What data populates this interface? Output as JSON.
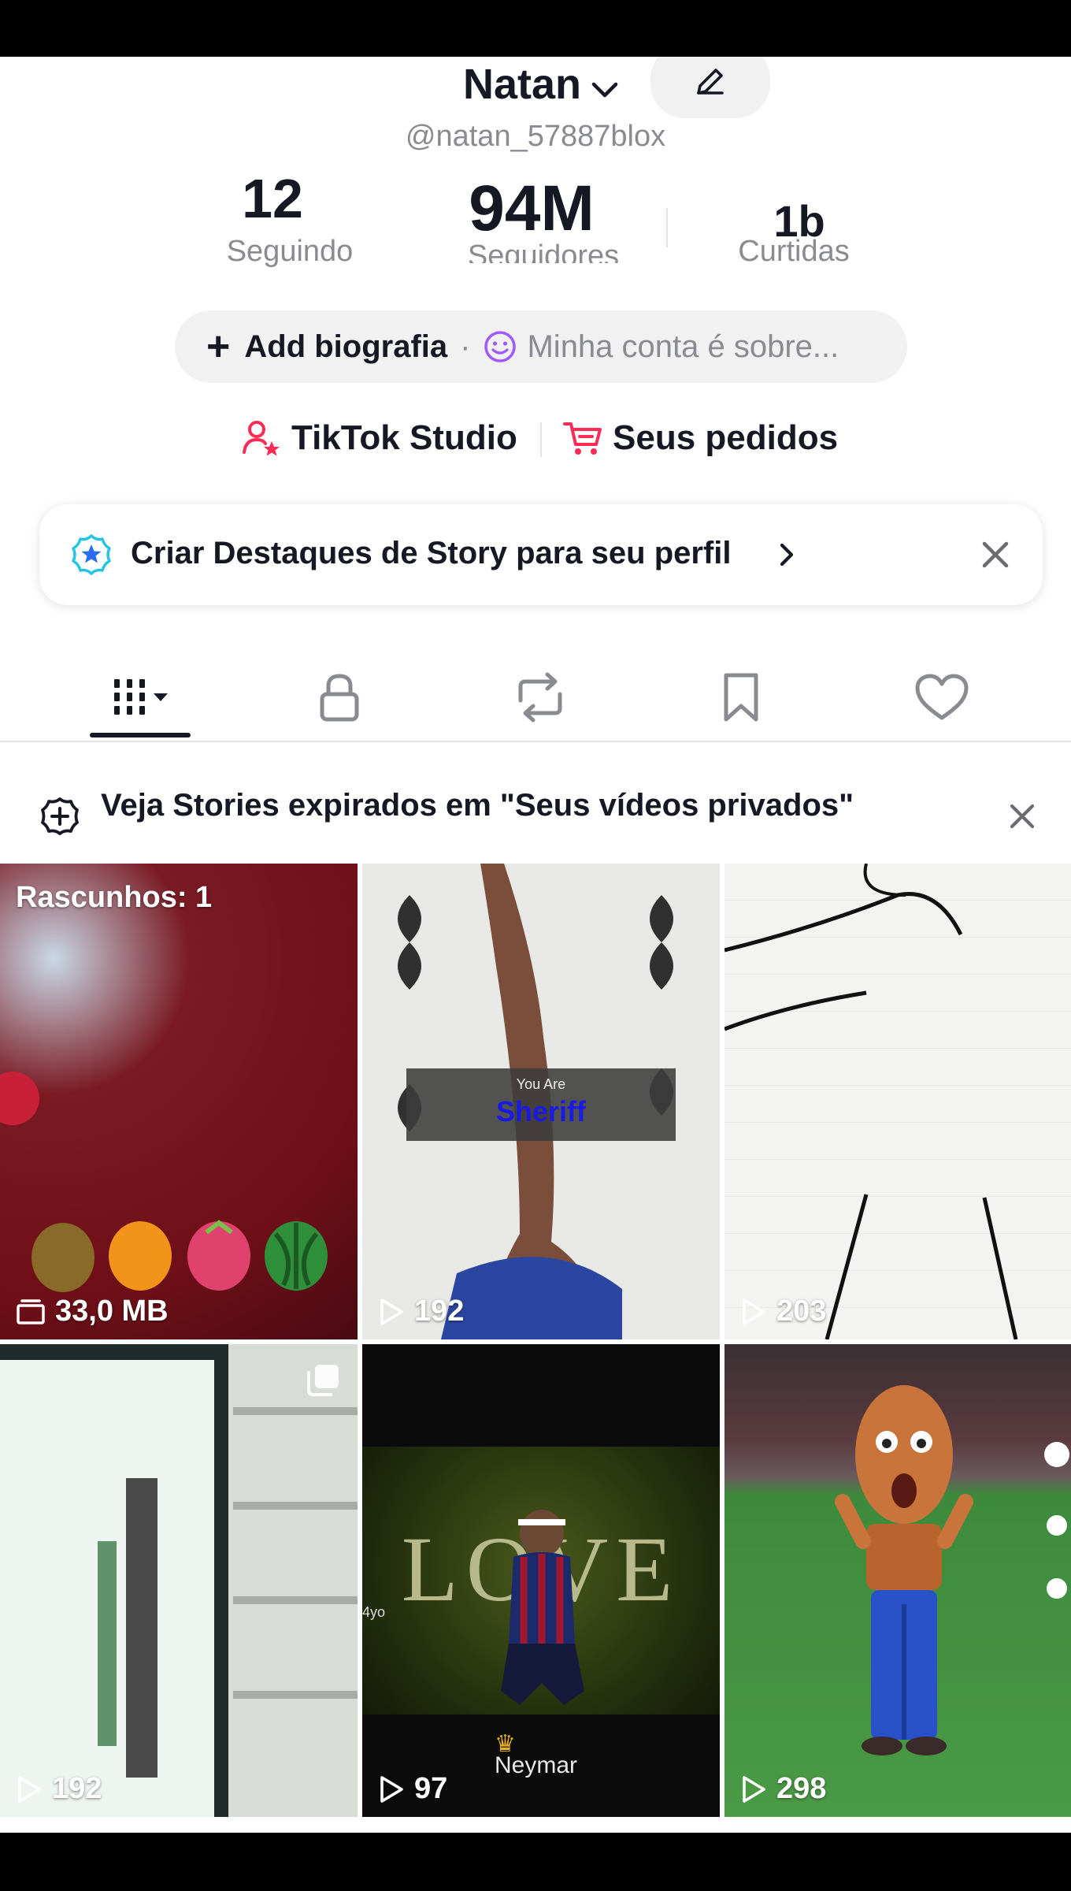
{
  "profile": {
    "name": "Natan",
    "handle": "@natan_57887blox"
  },
  "stats": {
    "following_count": "12",
    "following_label": "Seguindo",
    "followers_count": "94M",
    "followers_label": "Seguidores",
    "likes_count": "1b",
    "likes_label": "Curtidas"
  },
  "bio": {
    "add_label": "Add biografia",
    "separator": "·",
    "placeholder": "Minha conta é sobre..."
  },
  "links": {
    "studio": "TikTok Studio",
    "orders": "Seus pedidos"
  },
  "story_card": {
    "text": "Criar Destaques de Story para seu perfil"
  },
  "tabs": [
    "videos",
    "private",
    "reposts",
    "favorites",
    "liked"
  ],
  "notice": {
    "text": "Veja Stories expirados em \"Seus vídeos privados\""
  },
  "grid": {
    "draft_label": "Rascunhos: 1",
    "items": [
      {
        "label": "33,0 MB",
        "icon": "draft-folder-icon"
      },
      {
        "label": "192",
        "icon": "play-icon",
        "overlay": "You Are",
        "overlay2": "Sheriff"
      },
      {
        "label": "203",
        "icon": "play-icon"
      },
      {
        "label": "192",
        "icon": "play-icon"
      },
      {
        "label": "97",
        "icon": "play-icon",
        "overlay": "LOVE",
        "overlay2": "Neymar",
        "corner": "4yo"
      },
      {
        "label": "298",
        "icon": "play-icon"
      }
    ]
  },
  "colors": {
    "accent": "#fe2c55",
    "text": "#161823",
    "muted": "#8a8b91",
    "chip_bg": "#f1f1f2"
  }
}
